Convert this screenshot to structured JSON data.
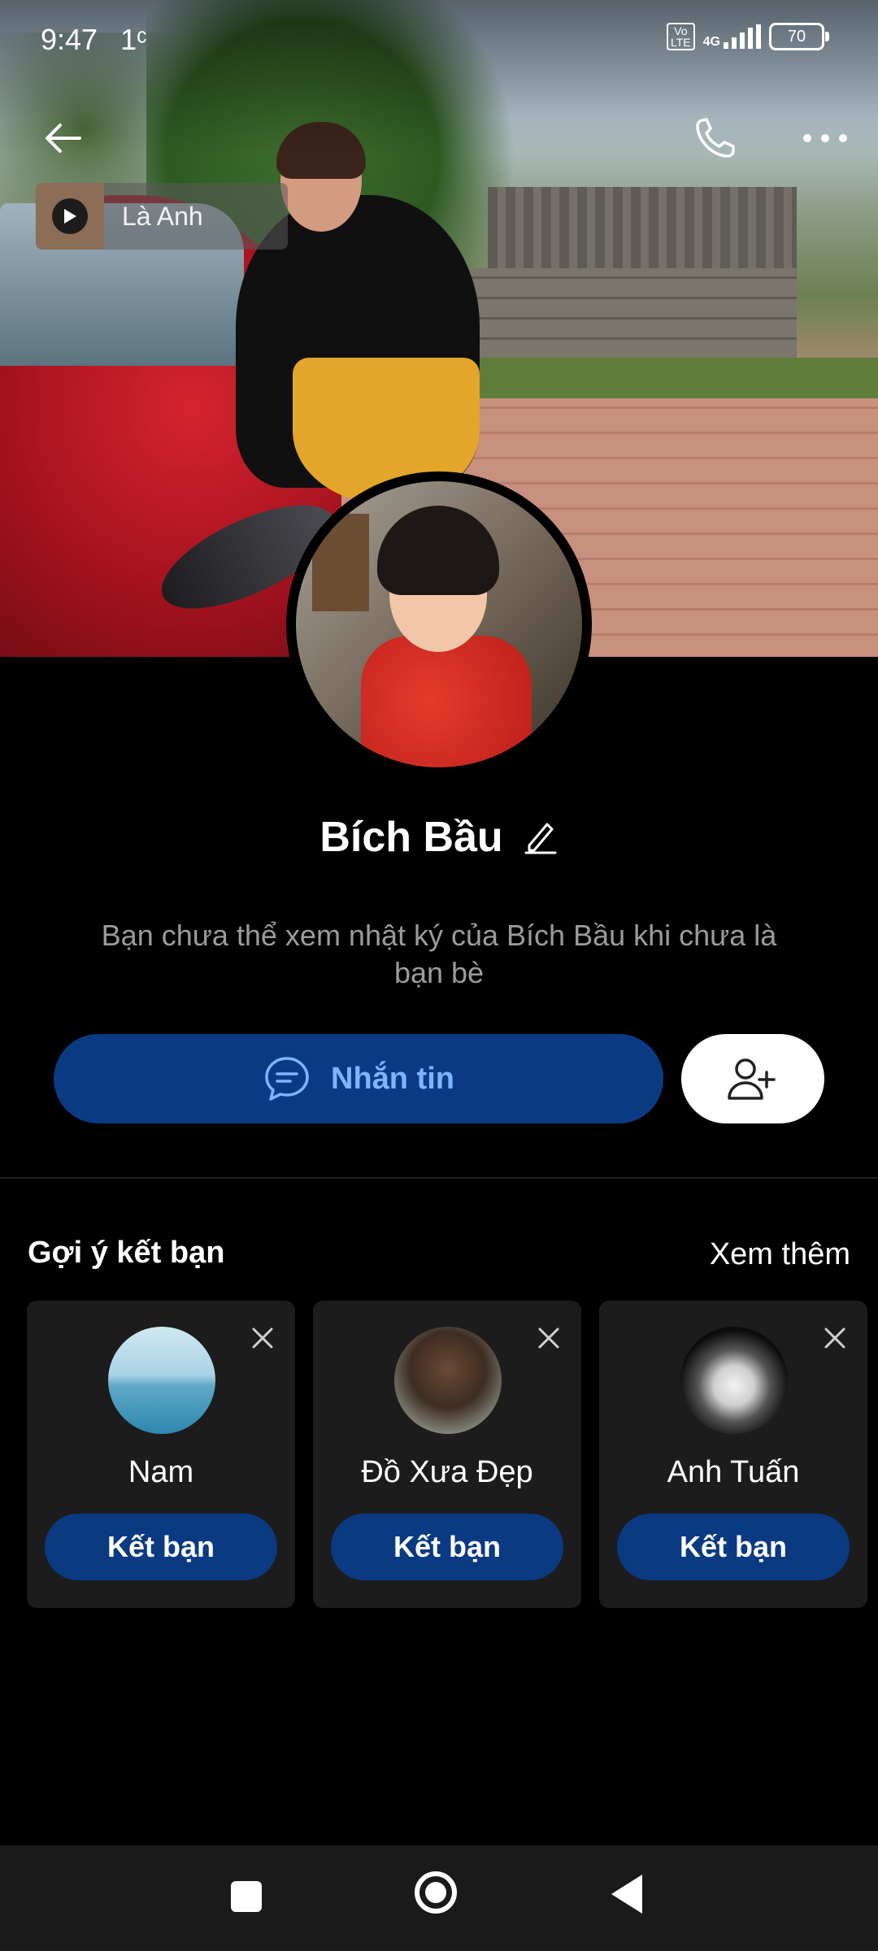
{
  "status_bar": {
    "time": "9:47",
    "notif": "1ᶜ",
    "volte_top": "Vo",
    "volte_bottom": "LTE",
    "network": "4G",
    "battery": "70"
  },
  "music": {
    "name": "Là Anh"
  },
  "profile": {
    "name": "Bích Bầu",
    "notice": "Bạn chưa thể xem nhật ký của Bích Bầu khi chưa là bạn bè",
    "message_label": "Nhắn tin"
  },
  "suggestions": {
    "title": "Gợi ý kết bạn",
    "see_more": "Xem thêm",
    "items": [
      {
        "name": "Nam",
        "button": "Kết bạn"
      },
      {
        "name": "Đồ Xưa Đẹp",
        "button": "Kết bạn"
      },
      {
        "name": "Anh Tuấn",
        "button": "Kết bạn"
      }
    ]
  },
  "icons": {
    "back": "arrow-left",
    "call": "phone",
    "more": "ellipsis",
    "edit": "pencil",
    "message": "chat-bubble",
    "add_friend": "user-plus",
    "close": "x"
  },
  "colors": {
    "accent_button": "#0a3a82",
    "accent_text": "#7eb4ff",
    "background": "#000000",
    "card": "#1c1c1c"
  }
}
